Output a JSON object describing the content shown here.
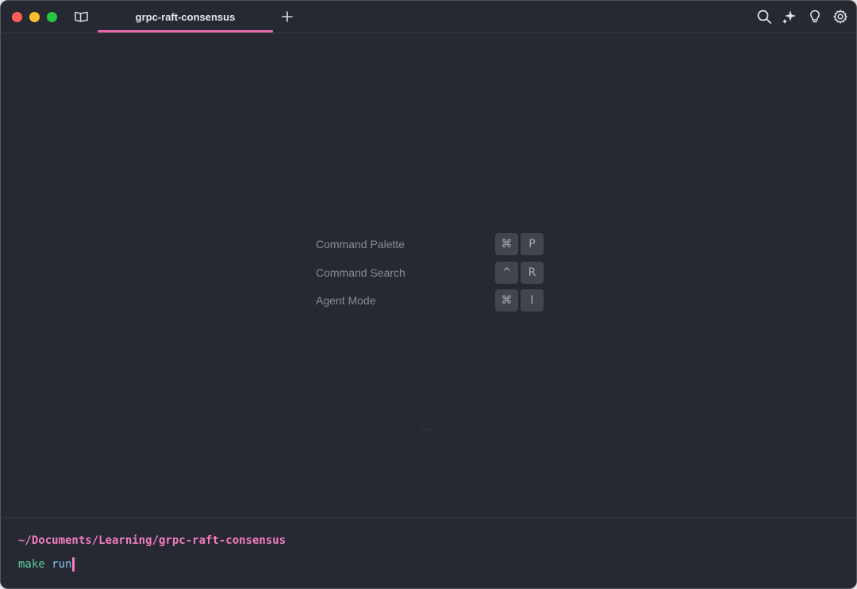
{
  "tab": {
    "title": "grpc-raft-consensus"
  },
  "icons": {
    "panel": "side-panel-icon",
    "new_tab": "plus-icon",
    "search": "search-icon",
    "ai": "sparkle-icon",
    "tips": "lightbulb-icon",
    "settings": "gear-icon"
  },
  "hints": [
    {
      "label": "Command Palette",
      "keys": [
        "⌘",
        "P"
      ]
    },
    {
      "label": "Command Search",
      "keys": [
        "^",
        "R"
      ]
    },
    {
      "label": "Agent Mode",
      "keys": [
        "⌘",
        "I"
      ]
    }
  ],
  "resize_dots": "···",
  "prompt": {
    "cwd": "~/Documents/Learning/grpc-raft-consensus",
    "command": "make",
    "argument": "run"
  },
  "colors": {
    "background": "#262832",
    "accent": "#e36aa6",
    "cwd": "#f17ec0",
    "command": "#5fd19b",
    "argument": "#83c3f0"
  }
}
